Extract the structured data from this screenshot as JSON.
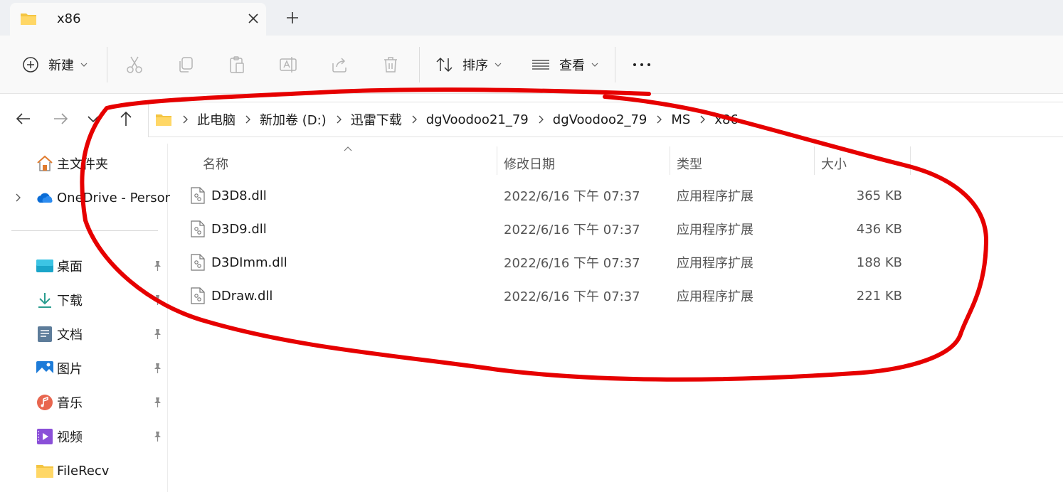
{
  "tab": {
    "title": "x86"
  },
  "toolbar": {
    "new_label": "新建",
    "sort_label": "排序",
    "view_label": "查看",
    "more_label": "···"
  },
  "breadcrumb": [
    "此电脑",
    "新加卷 (D:)",
    "迅雷下载",
    "dgVoodoo21_79",
    "dgVoodoo2_79",
    "MS",
    "x86"
  ],
  "sidebar": {
    "items": [
      {
        "label": "主文件夹",
        "icon": "home-icon"
      },
      {
        "label": "OneDrive - Persor",
        "icon": "onedrive-cloud-icon"
      },
      {
        "label": "桌面",
        "icon": "desktop-icon"
      },
      {
        "label": "下载",
        "icon": "download-icon"
      },
      {
        "label": "文档",
        "icon": "document-icon"
      },
      {
        "label": "图片",
        "icon": "pictures-icon"
      },
      {
        "label": "音乐",
        "icon": "music-icon"
      },
      {
        "label": "视频",
        "icon": "video-icon"
      },
      {
        "label": "FileRecv",
        "icon": "folder-icon"
      }
    ]
  },
  "columns": {
    "name": "名称",
    "modified": "修改日期",
    "type": "类型",
    "size": "大小"
  },
  "files": [
    {
      "name": "D3D8.dll",
      "modified": "2022/6/16 下午 07:37",
      "type": "应用程序扩展",
      "size": "365 KB"
    },
    {
      "name": "D3D9.dll",
      "modified": "2022/6/16 下午 07:37",
      "type": "应用程序扩展",
      "size": "436 KB"
    },
    {
      "name": "D3DImm.dll",
      "modified": "2022/6/16 下午 07:37",
      "type": "应用程序扩展",
      "size": "188 KB"
    },
    {
      "name": "DDraw.dll",
      "modified": "2022/6/16 下午 07:37",
      "type": "应用程序扩展",
      "size": "221 KB"
    }
  ],
  "colors": {
    "annotation": "#e60000",
    "folder": "#f4c542",
    "accent": "#0067c0"
  }
}
